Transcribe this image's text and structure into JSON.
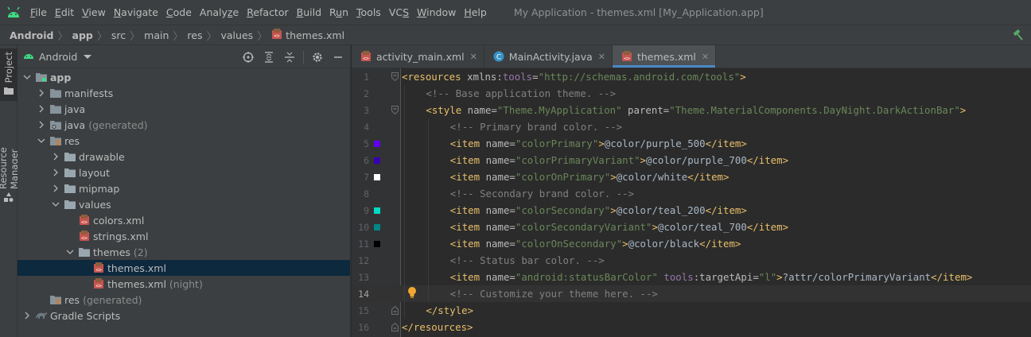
{
  "menubar": {
    "items": [
      {
        "label": "File",
        "u": "F",
        "rest": "ile"
      },
      {
        "label": "Edit",
        "u": "E",
        "rest": "dit"
      },
      {
        "label": "View",
        "u": "V",
        "rest": "iew"
      },
      {
        "label": "Navigate",
        "u": "N",
        "rest": "avigate"
      },
      {
        "label": "Code",
        "u": "C",
        "rest": "ode"
      },
      {
        "label": "Analyze",
        "pre": "Analy",
        "u": "z",
        "rest": "e"
      },
      {
        "label": "Refactor",
        "u": "R",
        "rest": "efactor"
      },
      {
        "label": "Build",
        "u": "B",
        "rest": "uild"
      },
      {
        "label": "Run",
        "pre": "R",
        "u": "u",
        "rest": "n"
      },
      {
        "label": "Tools",
        "u": "T",
        "rest": "ools"
      },
      {
        "label": "VCS",
        "pre": "VC",
        "u": "S",
        "rest": ""
      },
      {
        "label": "Window",
        "u": "W",
        "rest": "indow"
      },
      {
        "label": "Help",
        "u": "H",
        "rest": "elp"
      }
    ],
    "window_title": "My Application - themes.xml [My_Application.app]"
  },
  "breadcrumb": [
    "Android",
    "app",
    "src",
    "main",
    "res",
    "values",
    "themes.xml"
  ],
  "toolstrip": {
    "project_tab": "Project",
    "resource_tab": "Resource Manager"
  },
  "project_panel": {
    "view_selector": "Android",
    "tree": [
      {
        "label": "app",
        "suffix": "",
        "depth": 0,
        "arrow": "down",
        "icon": "module-folder-icon",
        "bold": true
      },
      {
        "label": "manifests",
        "suffix": "",
        "depth": 1,
        "arrow": "right",
        "icon": "folder-icon"
      },
      {
        "label": "java",
        "suffix": "",
        "depth": 1,
        "arrow": "right",
        "icon": "folder-icon"
      },
      {
        "label": "java",
        "suffix": "(generated)",
        "depth": 1,
        "arrow": "right",
        "icon": "generated-folder-icon"
      },
      {
        "label": "res",
        "suffix": "",
        "depth": 1,
        "arrow": "down",
        "icon": "res-folder-icon"
      },
      {
        "label": "drawable",
        "suffix": "",
        "depth": 2,
        "arrow": "right",
        "icon": "gray-folder-icon"
      },
      {
        "label": "layout",
        "suffix": "",
        "depth": 2,
        "arrow": "right",
        "icon": "gray-folder-icon"
      },
      {
        "label": "mipmap",
        "suffix": "",
        "depth": 2,
        "arrow": "right",
        "icon": "gray-folder-icon"
      },
      {
        "label": "values",
        "suffix": "",
        "depth": 2,
        "arrow": "down",
        "icon": "gray-folder-icon"
      },
      {
        "label": "colors.xml",
        "suffix": "",
        "depth": 3,
        "arrow": "none",
        "icon": "xml-file-icon"
      },
      {
        "label": "strings.xml",
        "suffix": "",
        "depth": 3,
        "arrow": "none",
        "icon": "xml-file-icon"
      },
      {
        "label": "themes",
        "suffix": "(2)",
        "depth": 3,
        "arrow": "down",
        "icon": "gray-folder-icon"
      },
      {
        "label": "themes.xml",
        "suffix": "",
        "depth": 4,
        "arrow": "none",
        "icon": "xml-file-icon",
        "selected": true
      },
      {
        "label": "themes.xml",
        "suffix": "(night)",
        "depth": 4,
        "arrow": "none",
        "icon": "xml-file-icon"
      },
      {
        "label": "res",
        "suffix": "(generated)",
        "depth": 1,
        "arrow": "none",
        "icon": "res-folder-icon"
      },
      {
        "label": "Gradle Scripts",
        "suffix": "",
        "depth": 0,
        "arrow": "right",
        "icon": "gradle-icon"
      }
    ]
  },
  "editor": {
    "tabs": [
      {
        "label": "activity_main.xml",
        "icon": "xml-file-icon",
        "active": false
      },
      {
        "label": "MainActivity.java",
        "icon": "java-class-icon",
        "active": false
      },
      {
        "label": "themes.xml",
        "icon": "xml-file-icon",
        "active": true
      }
    ],
    "current_line": 14,
    "lines": [
      {
        "n": "1",
        "swatch": "",
        "fold": "open",
        "tokens": [
          [
            "tag",
            "<resources "
          ],
          [
            "attr",
            "xmlns:"
          ],
          [
            "ns",
            "tools"
          ],
          [
            "attr",
            "="
          ],
          [
            "str",
            "\"http://schemas.android.com/tools\""
          ],
          [
            "tag",
            ">"
          ]
        ],
        "indent": 0
      },
      {
        "n": "2",
        "swatch": "",
        "fold": "",
        "tokens": [
          [
            "cmt",
            "<!-- Base application theme. -->"
          ]
        ],
        "indent": 1
      },
      {
        "n": "3",
        "swatch": "",
        "fold": "open",
        "tokens": [
          [
            "tag",
            "<style "
          ],
          [
            "attr",
            "name"
          ],
          [
            "attr",
            "="
          ],
          [
            "str",
            "\"Theme.MyApplication\""
          ],
          [
            "attr",
            " parent"
          ],
          [
            "attr",
            "="
          ],
          [
            "str",
            "\"Theme.MaterialComponents.DayNight.DarkActionBar\""
          ],
          [
            "tag",
            ">"
          ]
        ],
        "indent": 1
      },
      {
        "n": "4",
        "swatch": "",
        "fold": "",
        "tokens": [
          [
            "cmt",
            "<!-- Primary brand color. -->"
          ]
        ],
        "indent": 2
      },
      {
        "n": "5",
        "swatch": "#6200ee",
        "fold": "",
        "tokens": [
          [
            "tag",
            "<item "
          ],
          [
            "attr",
            "name"
          ],
          [
            "attr",
            "="
          ],
          [
            "str",
            "\"colorPrimary\""
          ],
          [
            "tag",
            ">"
          ],
          [
            "txt",
            "@color/purple_500"
          ],
          [
            "tag",
            "</item>"
          ]
        ],
        "indent": 2
      },
      {
        "n": "6",
        "swatch": "#3700b3",
        "fold": "",
        "tokens": [
          [
            "tag",
            "<item "
          ],
          [
            "attr",
            "name"
          ],
          [
            "attr",
            "="
          ],
          [
            "str",
            "\"colorPrimaryVariant\""
          ],
          [
            "tag",
            ">"
          ],
          [
            "txt",
            "@color/purple_700"
          ],
          [
            "tag",
            "</item>"
          ]
        ],
        "indent": 2
      },
      {
        "n": "7",
        "swatch": "#ffffff",
        "fold": "",
        "tokens": [
          [
            "tag",
            "<item "
          ],
          [
            "attr",
            "name"
          ],
          [
            "attr",
            "="
          ],
          [
            "str",
            "\"colorOnPrimary\""
          ],
          [
            "tag",
            ">"
          ],
          [
            "txt",
            "@color/white"
          ],
          [
            "tag",
            "</item>"
          ]
        ],
        "indent": 2
      },
      {
        "n": "8",
        "swatch": "",
        "fold": "",
        "tokens": [
          [
            "cmt",
            "<!-- Secondary brand color. -->"
          ]
        ],
        "indent": 2
      },
      {
        "n": "9",
        "swatch": "#03dac5",
        "fold": "",
        "tokens": [
          [
            "tag",
            "<item "
          ],
          [
            "attr",
            "name"
          ],
          [
            "attr",
            "="
          ],
          [
            "str",
            "\"colorSecondary\""
          ],
          [
            "tag",
            ">"
          ],
          [
            "txt",
            "@color/teal_200"
          ],
          [
            "tag",
            "</item>"
          ]
        ],
        "indent": 2
      },
      {
        "n": "10",
        "swatch": "#018786",
        "fold": "",
        "tokens": [
          [
            "tag",
            "<item "
          ],
          [
            "attr",
            "name"
          ],
          [
            "attr",
            "="
          ],
          [
            "str",
            "\"colorSecondaryVariant\""
          ],
          [
            "tag",
            ">"
          ],
          [
            "txt",
            "@color/teal_700"
          ],
          [
            "tag",
            "</item>"
          ]
        ],
        "indent": 2
      },
      {
        "n": "11",
        "swatch": "#000000",
        "fold": "",
        "tokens": [
          [
            "tag",
            "<item "
          ],
          [
            "attr",
            "name"
          ],
          [
            "attr",
            "="
          ],
          [
            "str",
            "\"colorOnSecondary\""
          ],
          [
            "tag",
            ">"
          ],
          [
            "txt",
            "@color/black"
          ],
          [
            "tag",
            "</item>"
          ]
        ],
        "indent": 2
      },
      {
        "n": "12",
        "swatch": "",
        "fold": "",
        "tokens": [
          [
            "cmt",
            "<!-- Status bar color. -->"
          ]
        ],
        "indent": 2
      },
      {
        "n": "13",
        "swatch": "",
        "fold": "",
        "tokens": [
          [
            "tag",
            "<item "
          ],
          [
            "attr",
            "name"
          ],
          [
            "attr",
            "="
          ],
          [
            "str",
            "\"android:statusBarColor\""
          ],
          [
            "attr",
            " "
          ],
          [
            "ns",
            "tools"
          ],
          [
            "attr",
            ":targetApi"
          ],
          [
            "attr",
            "="
          ],
          [
            "str",
            "\"l\""
          ],
          [
            "tag",
            ">"
          ],
          [
            "txt",
            "?attr/colorPrimaryVariant"
          ],
          [
            "tag",
            "</item>"
          ]
        ],
        "indent": 2
      },
      {
        "n": "14",
        "swatch": "",
        "fold": "",
        "bulb": true,
        "tokens": [
          [
            "cmt",
            "<!-- Customize your theme here. -->"
          ]
        ],
        "indent": 2
      },
      {
        "n": "15",
        "swatch": "",
        "fold": "close",
        "tokens": [
          [
            "tag",
            "</style>"
          ]
        ],
        "indent": 1
      },
      {
        "n": "16",
        "swatch": "",
        "fold": "close",
        "tokens": [
          [
            "tag",
            "</resources>"
          ]
        ],
        "indent": 0
      }
    ]
  },
  "colors": {
    "accent": "#4a88c7",
    "selection": "#0d293e",
    "android_green": "#3ddc84"
  }
}
